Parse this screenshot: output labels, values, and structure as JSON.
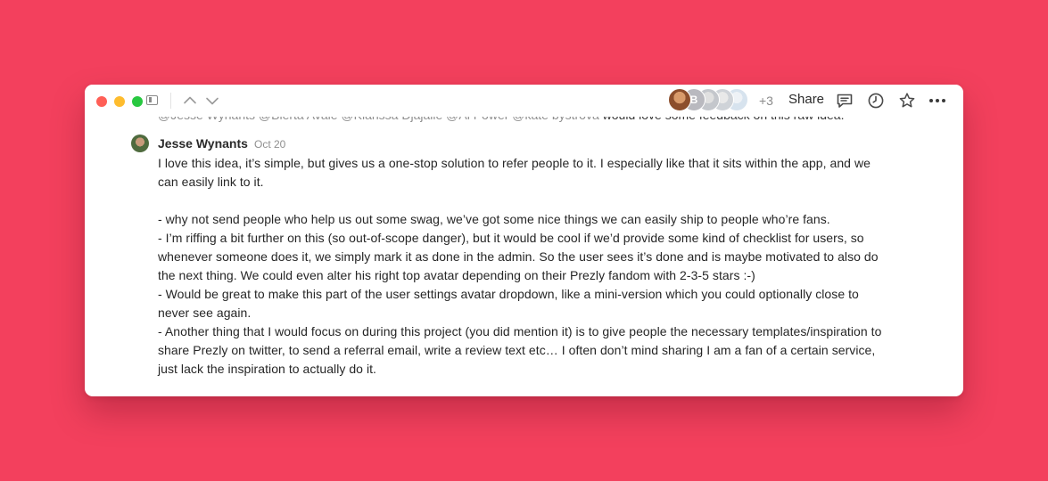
{
  "window": {
    "traffic_lights": [
      "close",
      "minimize",
      "maximize"
    ]
  },
  "toolbar": {
    "nav_up_icon": "chevron-up-icon",
    "nav_down_icon": "chevron-down-icon",
    "sidebar_icon": "sidebar-toggle-icon",
    "collaborators": [
      {
        "name": "avatar-1",
        "initial": ""
      },
      {
        "name": "avatar-2",
        "initial": "B"
      },
      {
        "name": "avatar-3",
        "initial": ""
      },
      {
        "name": "avatar-4",
        "initial": ""
      },
      {
        "name": "avatar-5",
        "initial": ""
      }
    ],
    "more_collaborators": "+3",
    "share_label": "Share",
    "icons": [
      "comments-icon",
      "history-icon",
      "star-icon",
      "more-icon"
    ]
  },
  "previous_comment": {
    "mentions": "@Jesse Wynants @Bierta Avale @Klarissa Djajalie @Ai Power @kate bystrova",
    "text": " would love some feedback on this raw idea."
  },
  "comment": {
    "author": "Jesse Wynants",
    "date": "Oct 20",
    "lines": [
      "I love this idea, it’s simple, but gives us a one-stop solution to refer people to it. I especially like that it sits within the app, and we",
      "can easily link to it.",
      "",
      "- why not send people who help us out some swag, we’ve got some nice things we can easily ship to people who’re fans.",
      "- I’m riffing a bit further on this (so out-of-scope danger), but it would be cool if we’d provide some kind of checklist for users, so",
      "whenever someone does it, we simply mark it as done in the admin. So the user sees it’s done and is maybe motivated to also do",
      "the next thing. We could even alter his right top avatar depending on their Prezly fandom with 2-3-5 stars :-)",
      "- Would be great to make this part of the user settings avatar dropdown, like a mini-version which you could optionally close to",
      "never see again.",
      "- Another thing that I would focus on during this project (you did mention it) is to give people the necessary templates/inspiration to",
      "share Prezly on twitter, to send a referral email, write a review text etc… I often don’t mind sharing I am a fan of a certain service,",
      "just lack the inspiration to actually do it."
    ]
  },
  "colors": {
    "background": "#f3405d",
    "window": "#ffffff",
    "text": "#262626",
    "muted": "#8f8f8f"
  }
}
